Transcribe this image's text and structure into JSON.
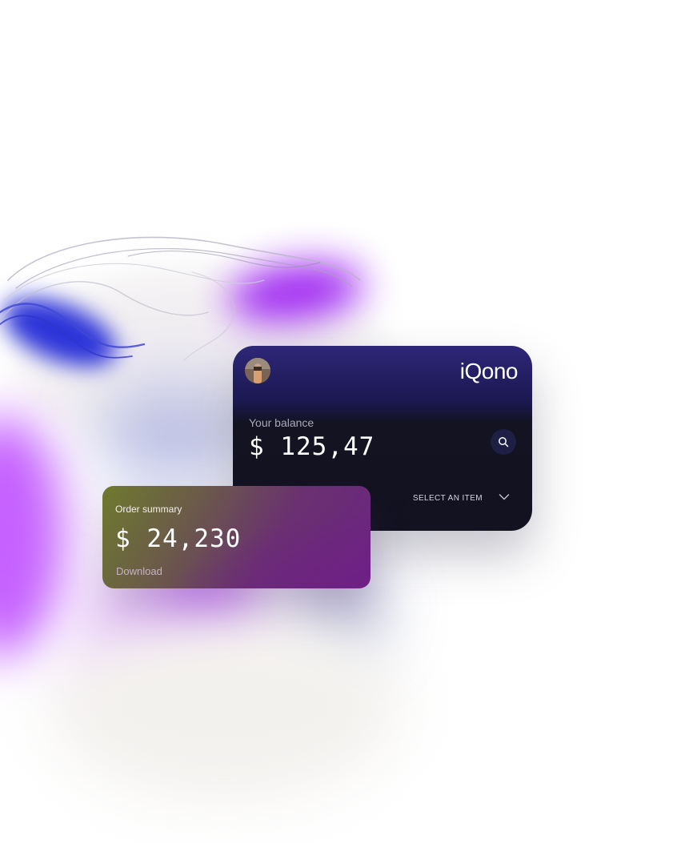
{
  "balance_card": {
    "brand": "iQono",
    "balance_label": "Your balance",
    "balance_amount": "$ 125,47",
    "select_label": "SELECT AN ITEM",
    "icons": {
      "search": "search-icon",
      "chevron": "chevron-down-icon",
      "avatar": "avatar"
    }
  },
  "order_card": {
    "title": "Order summary",
    "amount": "$ 24,230",
    "download_label": "Download"
  },
  "colors": {
    "balance_card_top": "#2e2778",
    "balance_card_bottom": "#121220",
    "order_card_left": "#6e7a2e",
    "order_card_right": "#6c2383",
    "accent_violet": "#9b1cf2",
    "accent_blue": "#2d34d8"
  }
}
